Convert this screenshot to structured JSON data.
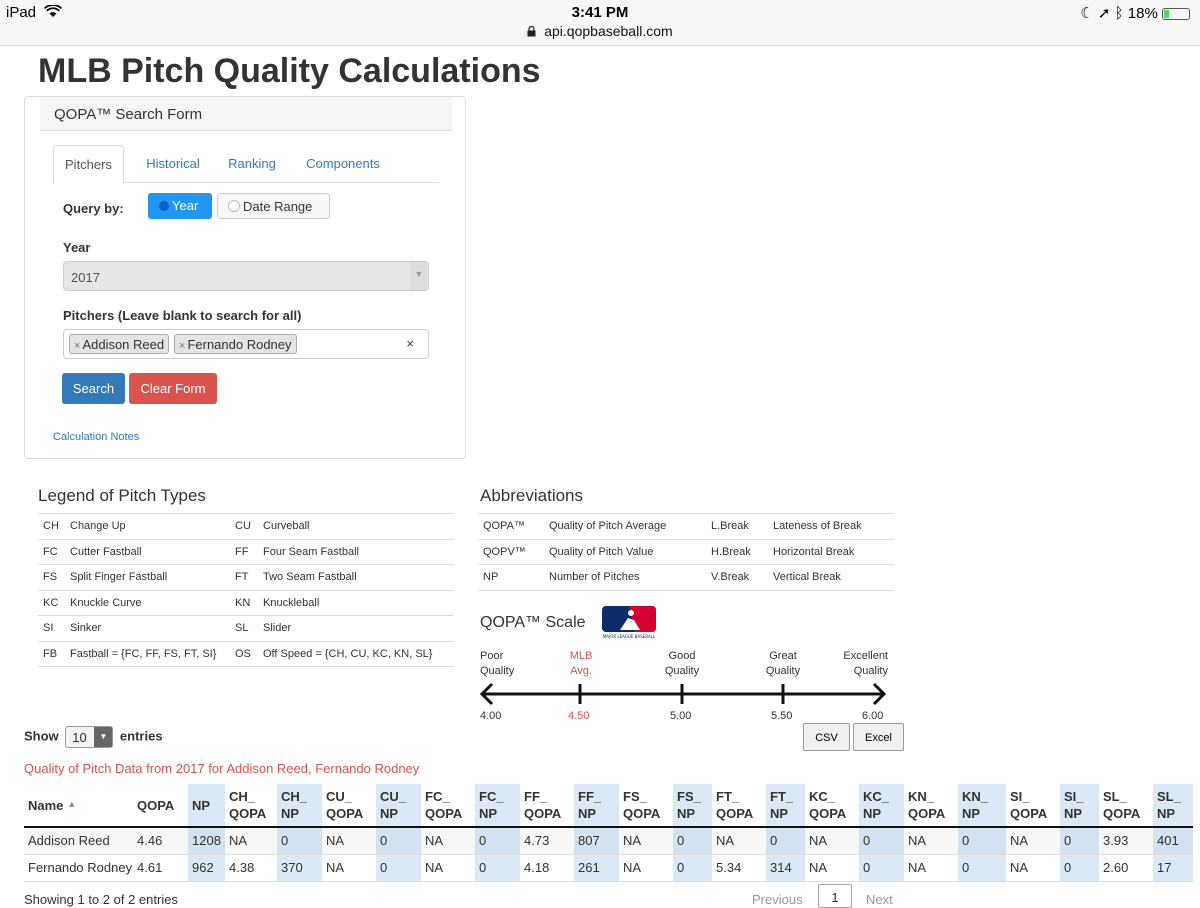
{
  "status_bar": {
    "device": "iPad",
    "time": "3:41 PM",
    "url": "api.qopbaseball.com",
    "battery": "18%"
  },
  "page_title": "MLB Pitch Quality Calculations",
  "search_form": {
    "title": "QOPA™ Search Form",
    "tabs": [
      "Pitchers",
      "Historical",
      "Ranking",
      "Components"
    ],
    "query_by_label": "Query by:",
    "query_options": [
      "Year",
      "Date Range"
    ],
    "year_label": "Year",
    "year_value": "2017",
    "pitchers_label": "Pitchers (Leave blank to search for all)",
    "selected_pitchers": [
      "Addison Reed",
      "Fernando Rodney"
    ],
    "clear_symbol": "×",
    "search_button": "Search",
    "clear_button": "Clear Form",
    "calculation_notes": "Calculation Notes"
  },
  "legend": {
    "title": "Legend of Pitch Types",
    "rows": [
      [
        "CH",
        "Change Up",
        "CU",
        "Curveball"
      ],
      [
        "FC",
        "Cutter Fastball",
        "FF",
        "Four Seam Fastball"
      ],
      [
        "FS",
        "Split Finger Fastball",
        "FT",
        "Two Seam Fastball"
      ],
      [
        "KC",
        "Knuckle Curve",
        "KN",
        "Knuckleball"
      ],
      [
        "SI",
        "Sinker",
        "SL",
        "Slider"
      ],
      [
        "FB",
        "Fastball = {FC, FF, FS, FT, SI}",
        "OS",
        "Off Speed = {CH, CU, KC, KN, SL}"
      ]
    ]
  },
  "abbreviations": {
    "title": "Abbreviations",
    "rows": [
      [
        "QOPA™",
        "Quality of Pitch Average",
        "L.Break",
        "Lateness of Break"
      ],
      [
        "QOPV™",
        "Quality of Pitch Value",
        "H.Break",
        "Horizontal Break"
      ],
      [
        "NP",
        "Number of Pitches",
        "V.Break",
        "Vertical Break"
      ]
    ]
  },
  "scale": {
    "title": "QOPA™ Scale",
    "labels": [
      {
        "line1": "Poor",
        "line2": "Quality"
      },
      {
        "line1": "MLB",
        "line2": "Avg."
      },
      {
        "line1": "Good",
        "line2": "Quality"
      },
      {
        "line1": "Great",
        "line2": "Quality"
      },
      {
        "line1": "Excellent",
        "line2": "Quality"
      }
    ],
    "values": [
      "4.00",
      "4.50",
      "5.00",
      "5.50",
      "6.00"
    ],
    "highlight_color": "#d9534f"
  },
  "table_controls": {
    "show_label": "Show",
    "page_length": "10",
    "entries_label": "entries",
    "csv_button": "CSV",
    "excel_button": "Excel"
  },
  "table_caption": "Quality of Pitch Data from 2017 for Addison Reed, Fernando Rodney",
  "data_table": {
    "headers": [
      [
        "Name",
        ""
      ],
      [
        "QOPA",
        ""
      ],
      [
        "NP",
        ""
      ],
      [
        "CH_",
        "QOPA"
      ],
      [
        "CH_",
        "NP"
      ],
      [
        "CU_",
        "QOPA"
      ],
      [
        "CU_",
        "NP"
      ],
      [
        "FC_",
        "QOPA"
      ],
      [
        "FC_",
        "NP"
      ],
      [
        "FF_",
        "QOPA"
      ],
      [
        "FF_",
        "NP"
      ],
      [
        "FS_",
        "QOPA"
      ],
      [
        "FS_",
        "NP"
      ],
      [
        "FT_",
        "QOPA"
      ],
      [
        "FT_",
        "NP"
      ],
      [
        "KC_",
        "QOPA"
      ],
      [
        "KC_",
        "NP"
      ],
      [
        "KN_",
        "QOPA"
      ],
      [
        "KN_",
        "NP"
      ],
      [
        "SI_",
        "QOPA"
      ],
      [
        "SI_",
        "NP"
      ],
      [
        "SL_",
        "QOPA"
      ],
      [
        "SL_",
        "NP"
      ]
    ],
    "rows": [
      [
        "Addison Reed",
        "4.46",
        "1208",
        "NA",
        "0",
        "NA",
        "0",
        "NA",
        "0",
        "4.73",
        "807",
        "NA",
        "0",
        "NA",
        "0",
        "NA",
        "0",
        "NA",
        "0",
        "NA",
        "0",
        "3.93",
        "401"
      ],
      [
        "Fernando Rodney",
        "4.61",
        "962",
        "4.38",
        "370",
        "NA",
        "0",
        "NA",
        "0",
        "4.18",
        "261",
        "NA",
        "0",
        "5.34",
        "314",
        "NA",
        "0",
        "NA",
        "0",
        "NA",
        "0",
        "2.60",
        "17"
      ]
    ]
  },
  "footer": {
    "info": "Showing 1 to 2 of 2 entries",
    "previous": "Previous",
    "current_page": "1",
    "next": "Next"
  }
}
